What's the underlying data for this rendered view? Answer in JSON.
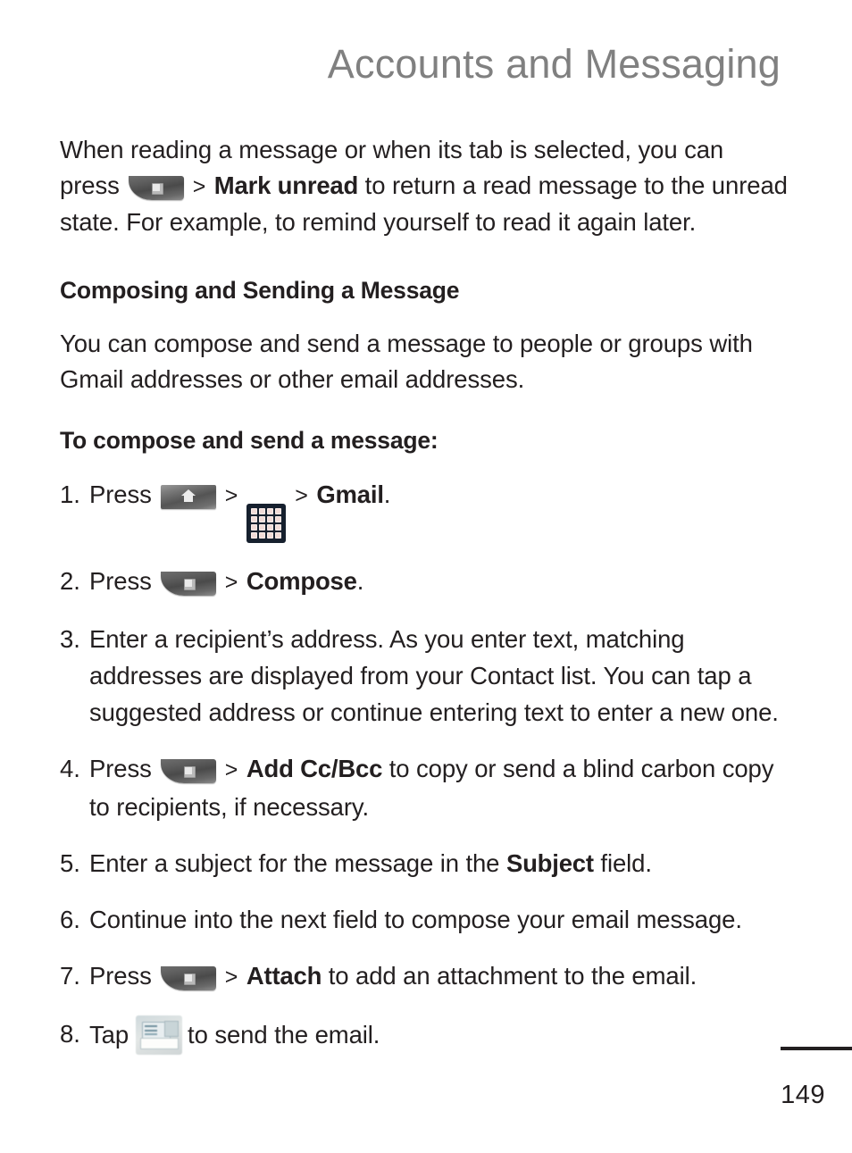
{
  "document": {
    "running_head": "Accounts and Messaging",
    "page_number": "149",
    "title_color": "#808080",
    "text_color": "#231f20"
  },
  "intro_paragraph": {
    "part1": "When reading a message or when its tab is selected, you can press",
    "chevron": ">",
    "bold_term": "Mark unread",
    "part2": "to return a read message to the unread state. For example, to remind yourself to read it again later.",
    "icon": "menu-key-icon"
  },
  "section": {
    "heading": "Composing and Sending a Message",
    "intro": "You can compose and send a message to people or groups with Gmail addresses or other email addresses.",
    "procedure_heading": "To compose and send a message:"
  },
  "steps": [
    {
      "number": "1.",
      "lead": "Press",
      "icon1": "home-key-icon",
      "chevron1": ">",
      "icon2": "apps-grid-icon",
      "chevron2": ">",
      "bold_term": "Gmail",
      "tail": "."
    },
    {
      "number": "2.",
      "lead": "Press",
      "icon1": "menu-key-icon",
      "chevron1": ">",
      "bold_term": "Compose",
      "tail": "."
    },
    {
      "number": "3.",
      "text": "Enter a recipient’s address. As you enter text, matching addresses are displayed from your Contact list. You can tap a suggested address or continue entering text to enter a new one."
    },
    {
      "number": "4.",
      "lead": "Press",
      "icon1": "menu-key-icon",
      "chevron1": ">",
      "bold_term": "Add Cc/Bcc",
      "tail": "to copy or send a blind carbon copy to recipients, if necessary."
    },
    {
      "number": "5.",
      "lead": "Enter a subject for the message in the",
      "bold_term": "Subject",
      "tail": "field."
    },
    {
      "number": "6.",
      "text": "Continue into the next field to compose your email message."
    },
    {
      "number": "7.",
      "lead": "Press",
      "icon1": "menu-key-icon",
      "chevron1": ">",
      "bold_term": "Attach",
      "tail": "to add an attachment to the email."
    },
    {
      "number": "8.",
      "lead": "Tap",
      "icon1": "send-email-icon",
      "tail": "to send the email."
    }
  ]
}
